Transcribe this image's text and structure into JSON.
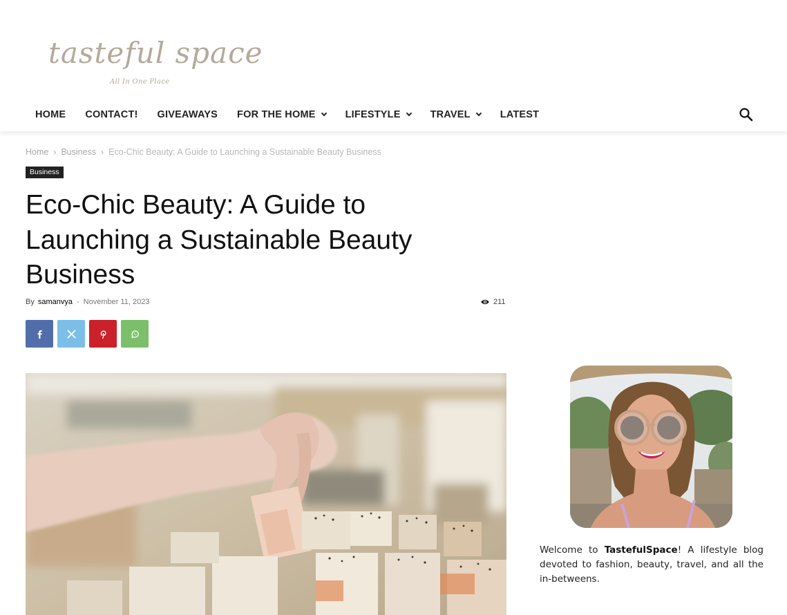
{
  "site": {
    "logo_text": "tasteful space",
    "tagline": "All In One Place"
  },
  "nav": {
    "items": [
      {
        "label": "HOME",
        "dropdown": false
      },
      {
        "label": "CONTACT!",
        "dropdown": false
      },
      {
        "label": "GIVEAWAYS",
        "dropdown": false
      },
      {
        "label": "FOR THE HOME",
        "dropdown": true
      },
      {
        "label": "LIFESTYLE",
        "dropdown": true
      },
      {
        "label": "TRAVEL",
        "dropdown": true
      },
      {
        "label": "LATEST",
        "dropdown": false
      }
    ],
    "search_icon": "search-icon"
  },
  "breadcrumb": {
    "home": "Home",
    "category": "Business",
    "current": "Eco-Chic Beauty: A Guide to Launching a Sustainable Beauty Business",
    "separator": "›"
  },
  "article": {
    "category_badge": "Business",
    "title": "Eco-Chic Beauty: A Guide to Launching a Sustainable Beauty Business",
    "by_label": "By",
    "author": "samanvya",
    "date_separator": "-",
    "date": "November 11, 2023",
    "views": "211"
  },
  "share": {
    "buttons": [
      {
        "network": "facebook",
        "icon": "facebook-icon",
        "color": "#516eab"
      },
      {
        "network": "x",
        "icon": "x-icon",
        "color": "#7bbfe9"
      },
      {
        "network": "pinterest",
        "icon": "pinterest-icon",
        "color": "#ca212a"
      },
      {
        "network": "whatsapp",
        "icon": "whatsapp-icon",
        "color": "#7bbf6a"
      }
    ]
  },
  "sidebar": {
    "welcome_prefix": "Welcome to ",
    "welcome_brand": "TastefulSpace",
    "welcome_suffix": "! A lifestyle blog devoted to fashion, beauty, travel, and all the in-betweens."
  },
  "colors": {
    "logo": "#b3aa9c",
    "nav_text": "#222222",
    "badge_bg": "#222222",
    "breadcrumb": "#a8a8a8"
  }
}
